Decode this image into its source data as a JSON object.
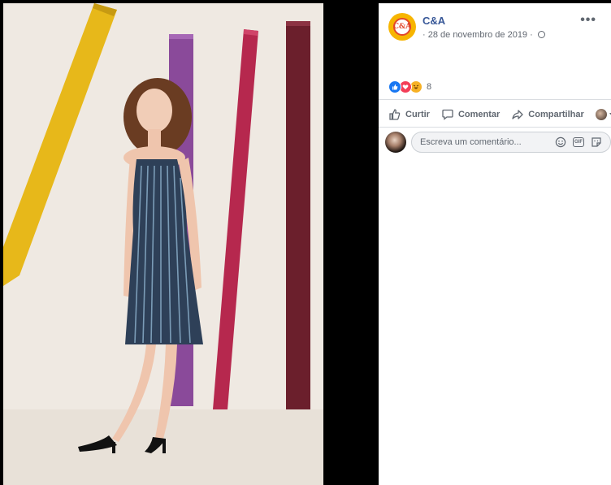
{
  "post": {
    "page_name": "C&A",
    "avatar_text": "C&A",
    "timestamp": "28 de novembro de 2019",
    "separator": "·",
    "more": "•••",
    "reactions": {
      "types": [
        "like-icon",
        "love-icon",
        "haha-icon"
      ],
      "count": "8"
    },
    "actions": {
      "like_label": "Curtir",
      "comment_label": "Comentar",
      "share_label": "Compartilhar"
    },
    "comment": {
      "placeholder": "Escreva um comentário..."
    }
  },
  "colors": {
    "link": "#385898",
    "brand_yellow": "#f7b500",
    "brand_red": "#e2462b",
    "like_blue": "#1877f2",
    "love_red": "#f33e58",
    "haha_yellow": "#f7b125"
  }
}
